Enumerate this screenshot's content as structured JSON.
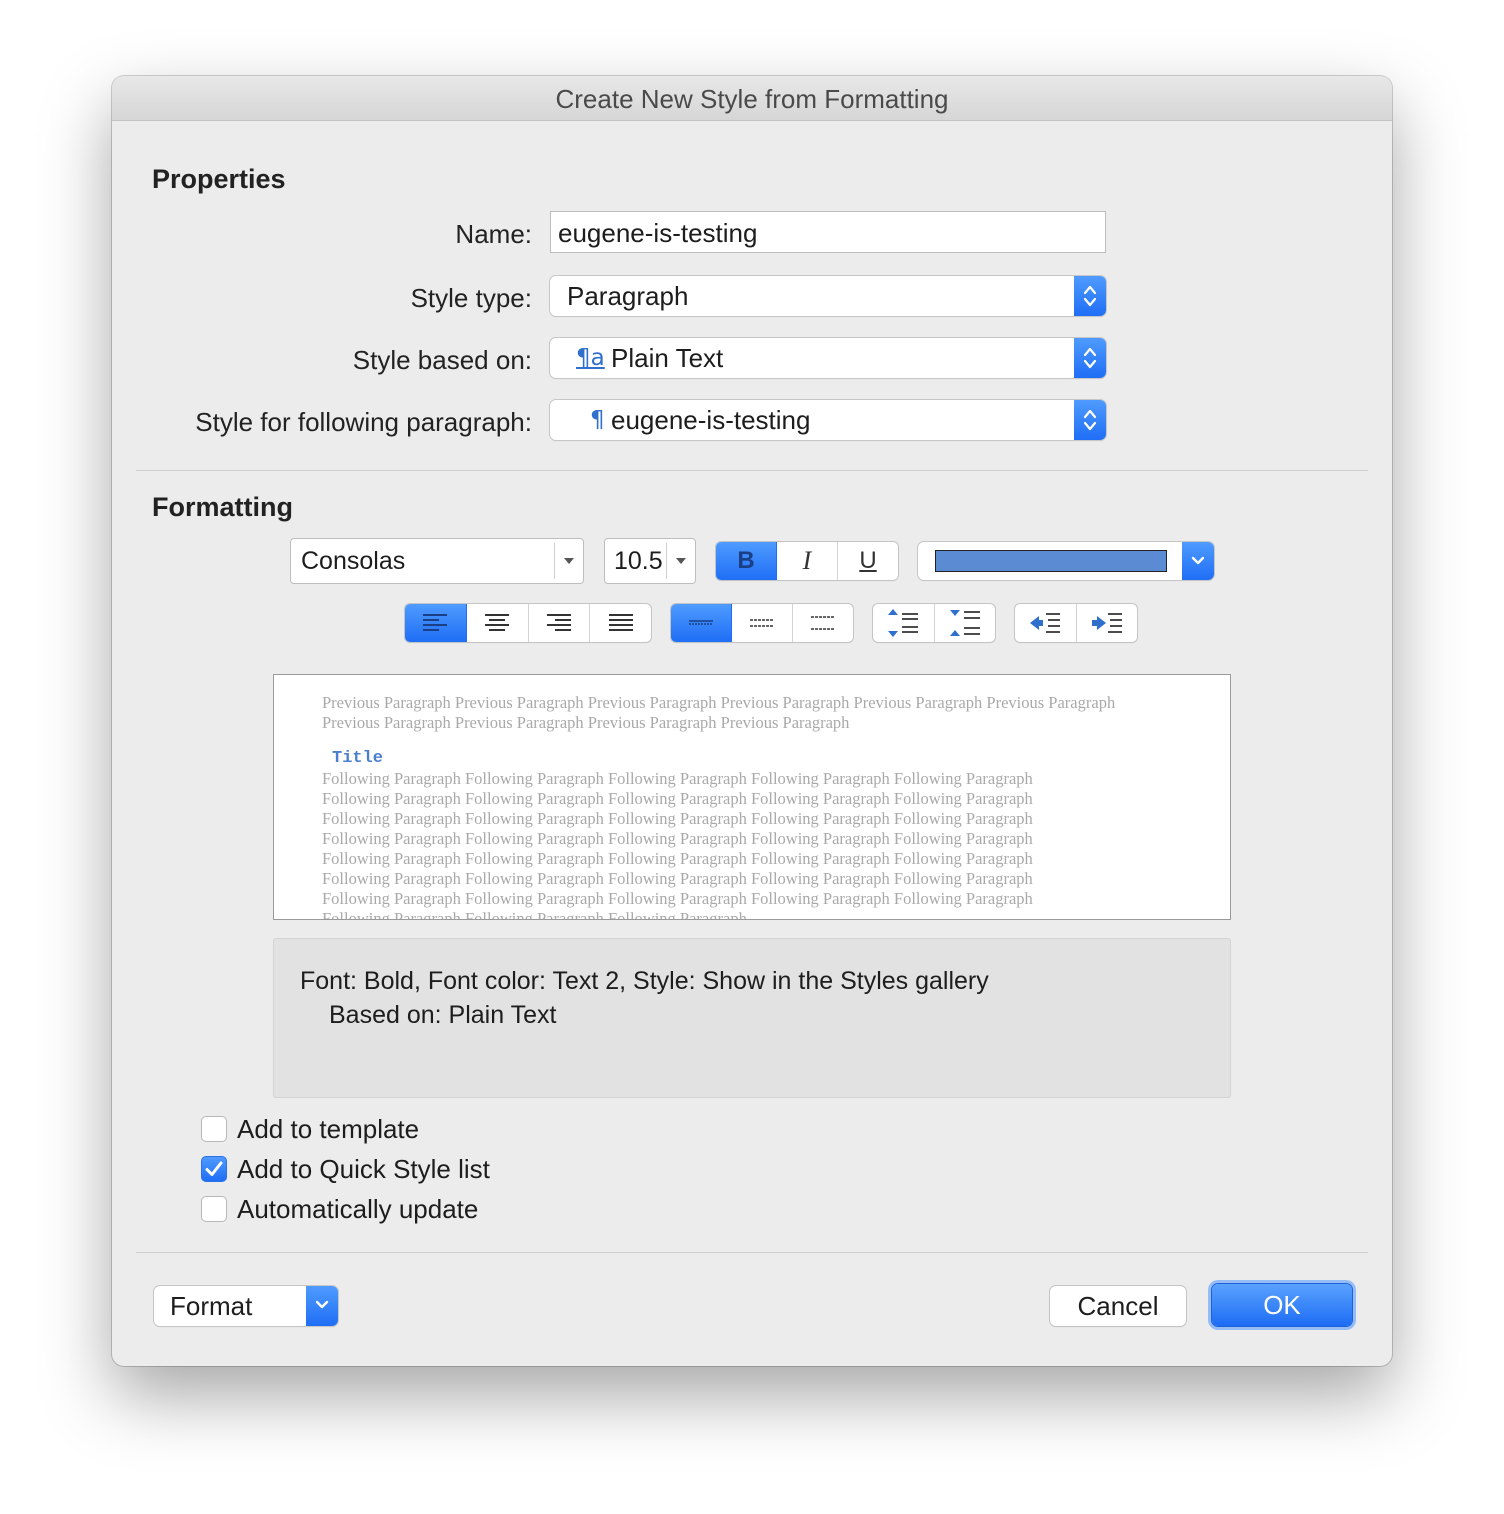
{
  "window": {
    "title": "Create New Style from Formatting"
  },
  "properties": {
    "section_title": "Properties",
    "name_label": "Name:",
    "name_value": "eugene-is-testing",
    "style_type_label": "Style type:",
    "style_type_value": "Paragraph",
    "based_on_label": "Style based on:",
    "based_on_icon_glyph": "¶a",
    "based_on_value": "Plain Text",
    "following_label": "Style for following paragraph:",
    "following_icon_glyph": "¶",
    "following_value": "eugene-is-testing"
  },
  "formatting": {
    "section_title": "Formatting",
    "font_name": "Consolas",
    "font_size": "10.5",
    "bold_glyph": "B",
    "italic_glyph": "I",
    "underline_glyph": "U",
    "bold_active": true,
    "font_color": "#5b8bd3",
    "alignment_active": "left",
    "line_spacing_active": "single"
  },
  "preview": {
    "previous_text": "Previous Paragraph Previous Paragraph Previous Paragraph Previous Paragraph Previous Paragraph Previous Paragraph Previous Paragraph Previous Paragraph Previous Paragraph Previous Paragraph",
    "sample_text": "Title",
    "following_lines": [
      "Following Paragraph Following Paragraph Following Paragraph Following Paragraph Following Paragraph",
      "Following Paragraph Following Paragraph Following Paragraph Following Paragraph Following Paragraph",
      "Following Paragraph Following Paragraph Following Paragraph Following Paragraph Following Paragraph",
      "Following Paragraph Following Paragraph Following Paragraph Following Paragraph Following Paragraph",
      "Following Paragraph Following Paragraph Following Paragraph Following Paragraph Following Paragraph",
      "Following Paragraph Following Paragraph Following Paragraph Following Paragraph Following Paragraph",
      "Following Paragraph Following Paragraph Following Paragraph Following Paragraph Following Paragraph",
      "Following Paragraph Following Paragraph Following Paragraph"
    ]
  },
  "description": {
    "line1": "Font: Bold, Font color: Text 2, Style: Show in the Styles gallery",
    "line2": "Based on: Plain Text"
  },
  "options": {
    "add_to_template": {
      "label": "Add to template",
      "checked": false
    },
    "add_to_quick_style": {
      "label": "Add to Quick Style list",
      "checked": true
    },
    "auto_update": {
      "label": "Automatically update",
      "checked": false
    }
  },
  "buttons": {
    "format": "Format",
    "cancel": "Cancel",
    "ok": "OK"
  },
  "colors": {
    "accent": "#1f6ef5",
    "sample_text": "#4a7fd0"
  }
}
